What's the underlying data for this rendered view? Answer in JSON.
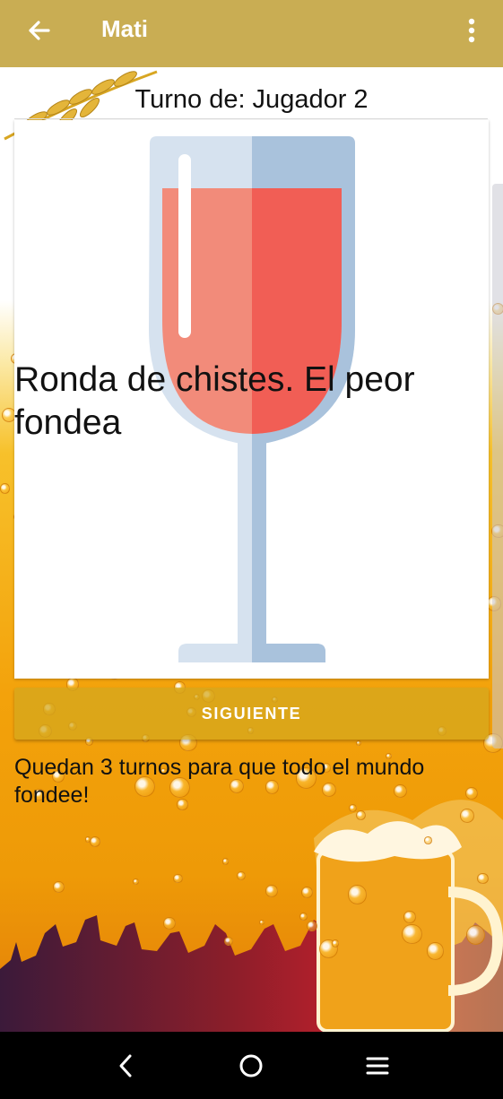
{
  "app_bar": {
    "title": "Mati",
    "back_icon": "arrow-left-icon",
    "menu_icon": "more-vertical-icon",
    "color": "#c9ad53"
  },
  "turn": {
    "label": "Turno de: Jugador 2"
  },
  "card": {
    "challenge_text": "Ronda de chistes. El peor fondea",
    "image": "wine-glass-icon"
  },
  "next_button": {
    "label": "SIGUIENTE"
  },
  "info": {
    "text": "Quedan 3 turnos para que todo el mundo fondee!"
  },
  "nav_bar": {
    "back": "nav-back-icon",
    "home": "nav-home-icon",
    "recents": "nav-menu-icon"
  }
}
